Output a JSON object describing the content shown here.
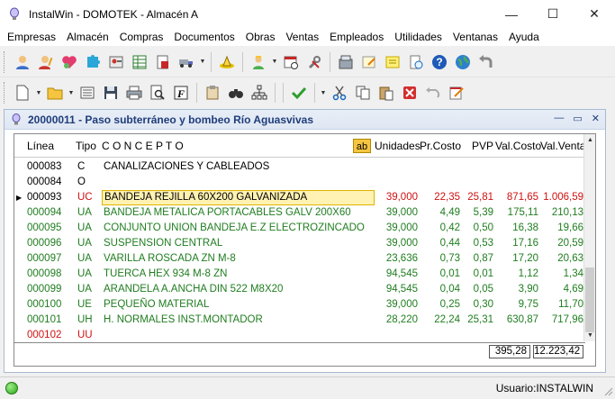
{
  "window": {
    "title": "InstalWin - DOMOTEK - Almacén A",
    "minimize": "—",
    "maximize": "☐",
    "close": "✕"
  },
  "menu": [
    "Empresas",
    "Almacén",
    "Compras",
    "Documentos",
    "Obras",
    "Ventas",
    "Empleados",
    "Utilidades",
    "Ventanas",
    "Ayuda"
  ],
  "document": {
    "title": "20000011 - Paso subterráneo y bombeo Río Aguasvivas"
  },
  "grid": {
    "headers": {
      "linea": "Línea",
      "tipo": "Tipo",
      "concepto": "C O N C E P T O",
      "ab": "ab",
      "unidades": "Unidades",
      "pr_costo": "Pr.Costo",
      "pvp": "PVP",
      "val_costo": "Val.Costo",
      "val_venta": "Val.Venta"
    },
    "rows": [
      {
        "linea": "000083",
        "tipo": "C",
        "concepto": "CANALIZACIONES Y CABLEADOS",
        "unidades": "",
        "pr_costo": "",
        "pvp": "",
        "val_costo": "",
        "val_venta": "",
        "style": "black"
      },
      {
        "linea": "000084",
        "tipo": "O",
        "concepto": "",
        "unidades": "",
        "pr_costo": "",
        "pvp": "",
        "val_costo": "",
        "val_venta": "",
        "style": "black"
      },
      {
        "linea": "000093",
        "tipo": "UC",
        "concepto": "BANDEJA REJILLA 60X200  GALVANIZADA",
        "unidades": "39,000",
        "pr_costo": "22,35",
        "pvp": "25,81",
        "val_costo": "871,65",
        "val_venta": "1.006,59",
        "style": "selected"
      },
      {
        "linea": "000094",
        "tipo": "UA",
        "concepto": "BANDEJA METALICA PORTACABLES GALV 200X60",
        "unidades": "39,000",
        "pr_costo": "4,49",
        "pvp": "5,39",
        "val_costo": "175,11",
        "val_venta": "210,13",
        "style": "green"
      },
      {
        "linea": "000095",
        "tipo": "UA",
        "concepto": "CONJUNTO UNION BANDEJA E.Z ELECTROZINCADO",
        "unidades": "39,000",
        "pr_costo": "0,42",
        "pvp": "0,50",
        "val_costo": "16,38",
        "val_venta": "19,66",
        "style": "green"
      },
      {
        "linea": "000096",
        "tipo": "UA",
        "concepto": "SUSPENSION CENTRAL",
        "unidades": "39,000",
        "pr_costo": "0,44",
        "pvp": "0,53",
        "val_costo": "17,16",
        "val_venta": "20,59",
        "style": "green"
      },
      {
        "linea": "000097",
        "tipo": "UA",
        "concepto": "VARILLA ROSCADA ZN M-8",
        "unidades": "23,636",
        "pr_costo": "0,73",
        "pvp": "0,87",
        "val_costo": "17,20",
        "val_venta": "20,63",
        "style": "green"
      },
      {
        "linea": "000098",
        "tipo": "UA",
        "concepto": "TUERCA HEX 934 M-8 ZN",
        "unidades": "94,545",
        "pr_costo": "0,01",
        "pvp": "0,01",
        "val_costo": "1,12",
        "val_venta": "1,34",
        "style": "green"
      },
      {
        "linea": "000099",
        "tipo": "UA",
        "concepto": "ARANDELA A.ANCHA DIN 522 M8X20",
        "unidades": "94,545",
        "pr_costo": "0,04",
        "pvp": "0,05",
        "val_costo": "3,90",
        "val_venta": "4,69",
        "style": "green"
      },
      {
        "linea": "000100",
        "tipo": "UE",
        "concepto": "PEQUEÑO MATERIAL",
        "unidades": "39,000",
        "pr_costo": "0,25",
        "pvp": "0,30",
        "val_costo": "9,75",
        "val_venta": "11,70",
        "style": "green"
      },
      {
        "linea": "000101",
        "tipo": "UH",
        "concepto": "H. NORMALES INST.MONTADOR",
        "unidades": "28,220",
        "pr_costo": "22,24",
        "pvp": "25,31",
        "val_costo": "630,87",
        "val_venta": "717,96",
        "style": "green"
      },
      {
        "linea": "000102",
        "tipo": "UU",
        "concepto": "",
        "unidades": "",
        "pr_costo": "",
        "pvp": "",
        "val_costo": "",
        "val_venta": "",
        "style": "red"
      }
    ],
    "totals": {
      "val_costo": "395,28",
      "val_venta": "12.223,42"
    }
  },
  "status": {
    "user": "Usuario:INSTALWIN"
  },
  "colors": {
    "green": "#1f7d1f",
    "red": "#d01010",
    "selected_bg": "#fff2b3",
    "accent": "#1f3d7a"
  }
}
